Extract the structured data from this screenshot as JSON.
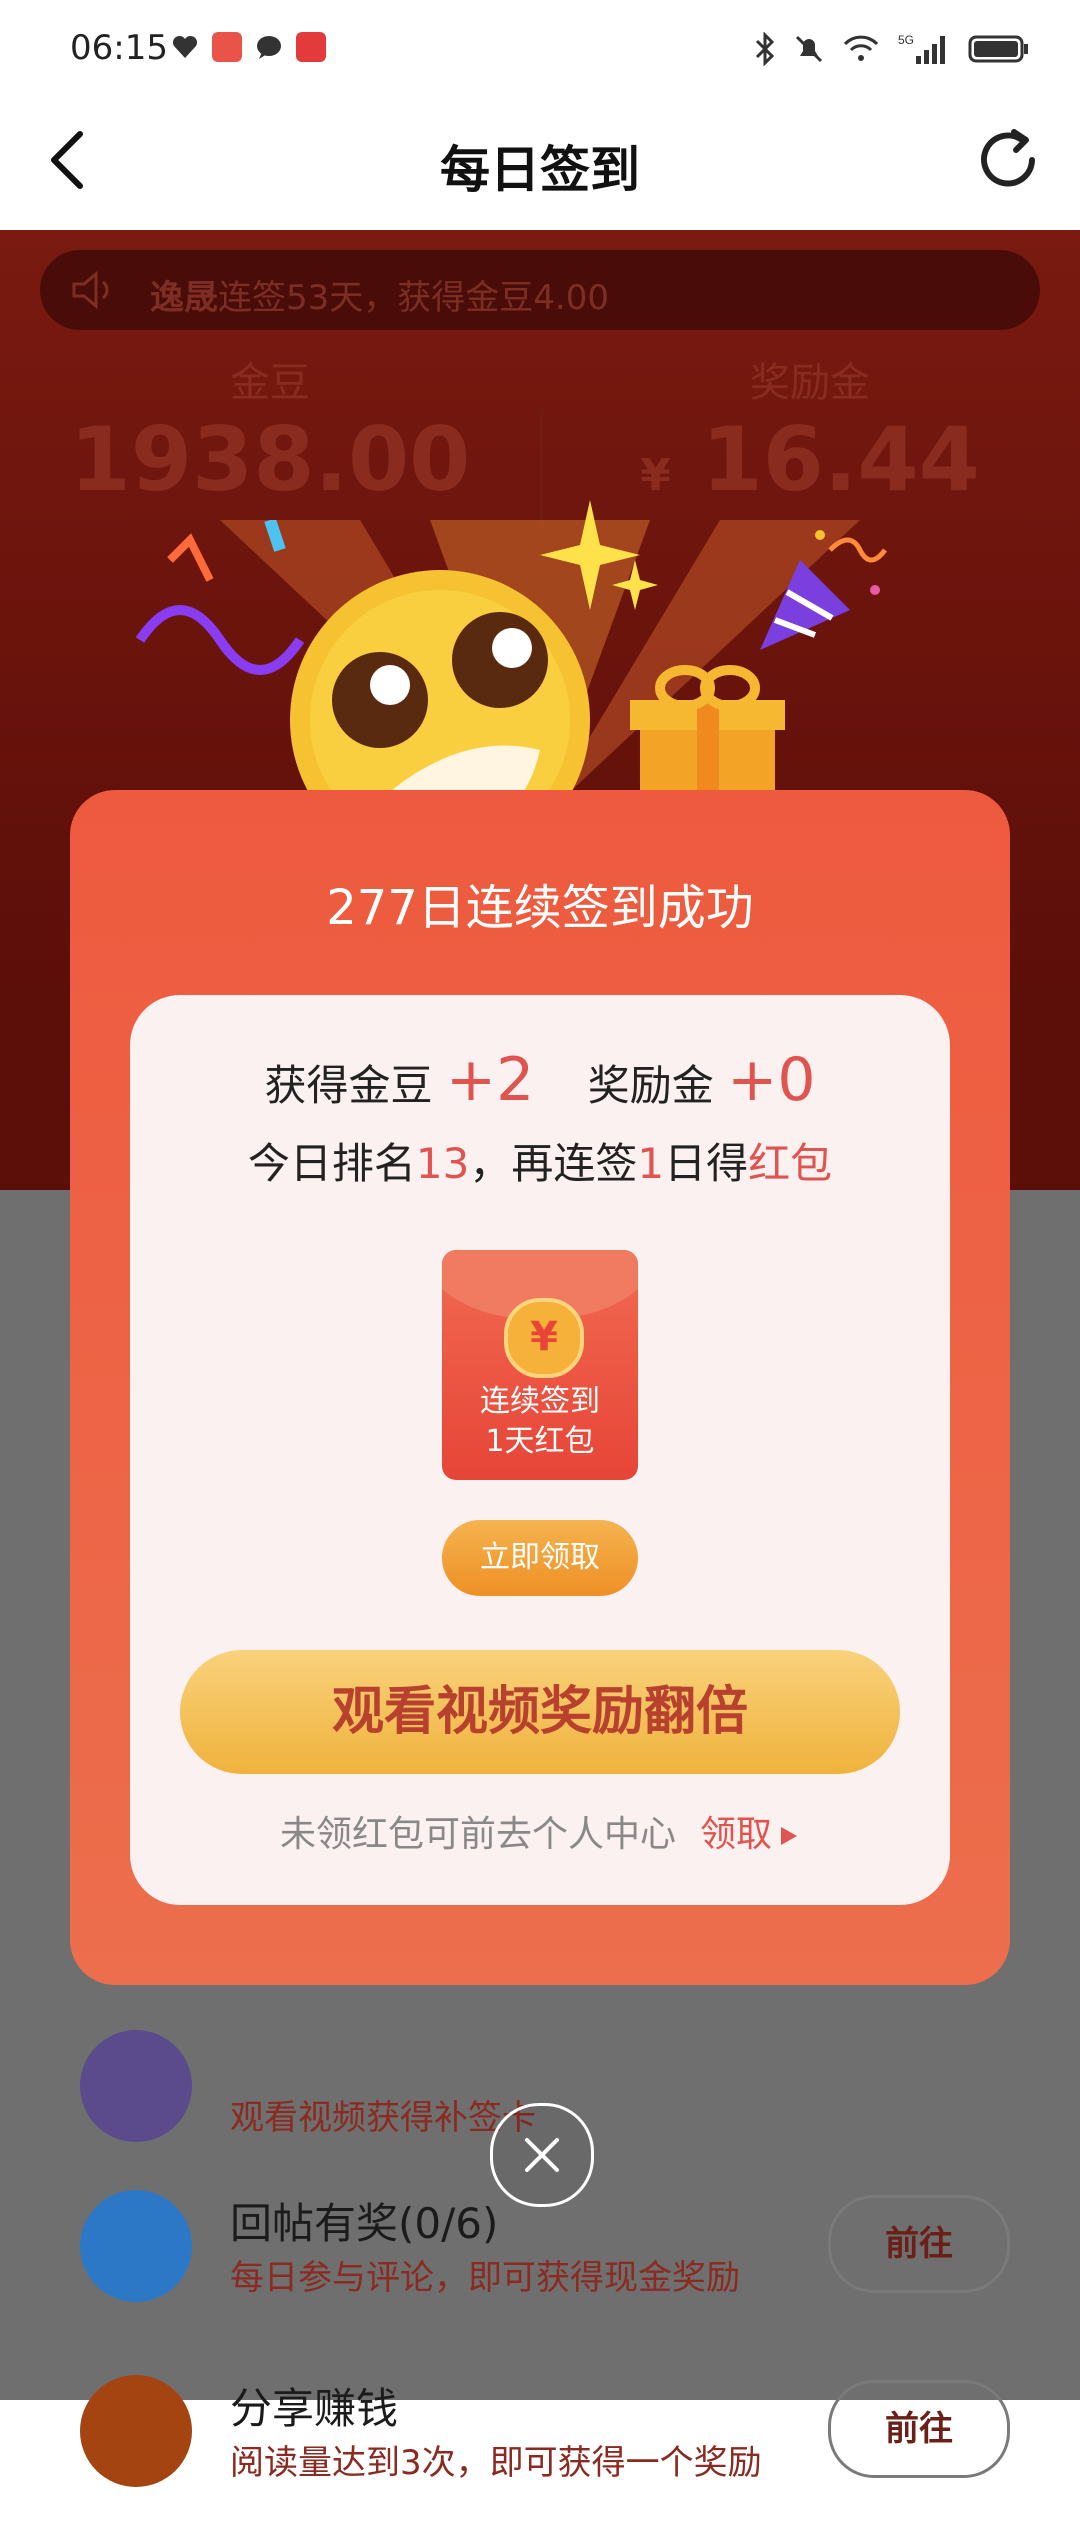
{
  "status_bar": {
    "time": "06:15",
    "icons_left": [
      "heart-icon",
      "app-icon",
      "chat-icon",
      "mail-icon"
    ],
    "icons_right": [
      "bluetooth-icon",
      "mute-icon",
      "wifi-icon",
      "signal-5g-icon",
      "battery-icon"
    ],
    "network": "5G"
  },
  "header": {
    "title": "每日签到"
  },
  "background": {
    "marquee": {
      "name": "逸晟",
      "text": "连签53天，获得金豆4.00"
    },
    "gold_beans": {
      "label": "金豆",
      "value": "1938.00"
    },
    "reward": {
      "label": "奖励金",
      "currency": "¥",
      "value": "16.44"
    },
    "tasks": [
      {
        "title": "",
        "subtitle": "观看视频获得补签卡",
        "button": ""
      },
      {
        "title": "回帖有奖(0/6)",
        "subtitle": "每日参与评论，即可获得现金奖励",
        "button": "前往"
      },
      {
        "title": "分享赚钱",
        "subtitle": "阅读量达到3次，即可获得一个奖励",
        "button": "前往"
      }
    ]
  },
  "modal": {
    "title": "277日连续签到成功",
    "earned_beans_label": "获得金豆",
    "earned_beans_value": "+2",
    "reward_label": "奖励金",
    "reward_value": "+0",
    "rank_prefix": "今日排名",
    "rank_value": "13",
    "rank_middle": "，再连签",
    "days_value": "1",
    "days_suffix": "日得",
    "red_packet_word": "红包",
    "envelope": {
      "coin_symbol": "¥",
      "line1": "连续签到",
      "line2": "1天红包"
    },
    "claim_button": "立即领取",
    "watch_video_button": "观看视频奖励翻倍",
    "footer_text": "未领红包可前去个人中心",
    "footer_link": "领取"
  },
  "colors": {
    "modal_bg": "#ee5a3f",
    "accent_red": "#e05450",
    "gold_button": "#f0b23c",
    "claim_button": "#ee9025"
  }
}
